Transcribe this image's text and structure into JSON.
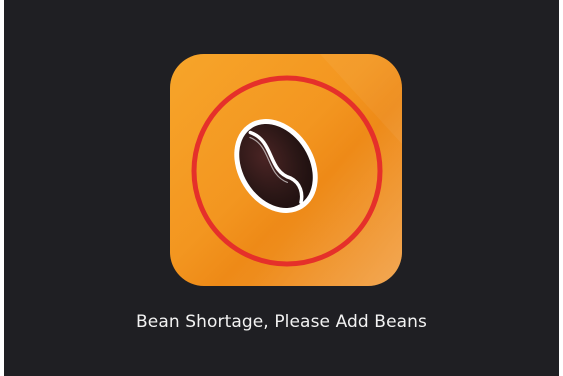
{
  "alert": {
    "icon": "coffee-bean-icon",
    "message": "Bean Shortage, Please Add Beans"
  },
  "colors": {
    "background": "#1f1f23",
    "tile_orange": "#f39620",
    "warning_ring": "#e5302a",
    "bean_dark": "#2b1716",
    "text": "#f2f2f2"
  }
}
